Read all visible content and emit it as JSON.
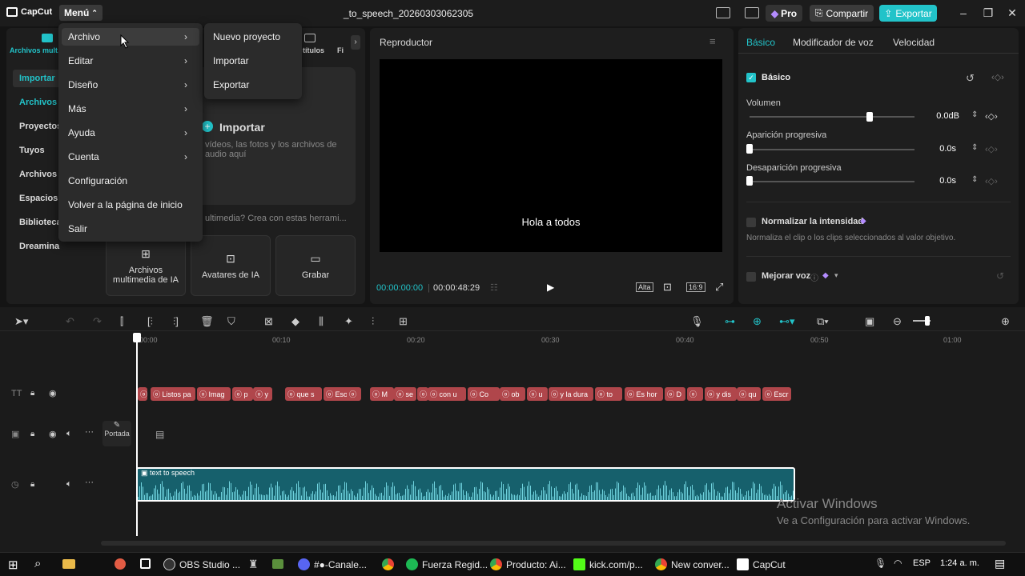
{
  "app": {
    "logo": "CapCut",
    "menu_label": "Menú",
    "project_title": "_to_speech_20260303062305"
  },
  "titlebar": {
    "pro_label": "Pro",
    "share_label": "Compartir",
    "export_label": "Exportar"
  },
  "left_panel": {
    "tabs": [
      {
        "label": "Archivos mult..."
      },
      {
        "label": "títulos"
      },
      {
        "label": "Fi"
      }
    ],
    "sidebar": [
      {
        "label": "Importar"
      },
      {
        "label": "Archivos"
      },
      {
        "label": "Proyectos"
      },
      {
        "label": "Tuyos"
      },
      {
        "label": "Archivos"
      },
      {
        "label": "Espacios"
      },
      {
        "label": "Biblioteca"
      },
      {
        "label": "Dreamina"
      }
    ],
    "import_label": "Importar",
    "import_hint": "vídeos, las fotos y los archivos de audio aquí",
    "ai_prompt": "ultimedia? Crea con estas herrami...",
    "ai_cards": [
      {
        "label": "Archivos multimedia de IA"
      },
      {
        "label": "Avatares de IA"
      },
      {
        "label": "Grabar"
      }
    ]
  },
  "player": {
    "title": "Reproductor",
    "subtitle": "Hola a todos",
    "current_time": "00:00:00:00",
    "total_time": "00:00:48:29",
    "quality": "Alta",
    "ratio": "16:9"
  },
  "right_panel": {
    "tabs": [
      "Básico",
      "Modificador de voz",
      "Velocidad"
    ],
    "section": "Básico",
    "volume_label": "Volumen",
    "volume_value": "0.0dB",
    "volume_level": 0.75,
    "fade_in_label": "Aparición progresiva",
    "fade_in_value": "0.0s",
    "fade_in_level": 0,
    "fade_out_label": "Desaparición progresiva",
    "fade_out_value": "0.0s",
    "fade_out_level": 0,
    "normalize_label": "Normalizar la intensidad",
    "normalize_desc": "Normaliza el clip o los clips seleccionados al valor objetivo.",
    "enhance_label": "Mejorar voz"
  },
  "timeline": {
    "ruler": [
      "00:00",
      "00:10",
      "00:20",
      "00:30",
      "00:40",
      "00:50",
      "01:00"
    ],
    "cover_label": "Portada",
    "audio_clip_label": "text to speech",
    "text_clips": [
      "",
      "Listos pa",
      "Imag",
      "p",
      "y",
      "que s",
      "Eso e",
      "",
      "M",
      "se",
      "",
      "con u",
      "Co",
      "ob",
      "u",
      "y la dura",
      "to",
      "Es hor",
      "D",
      "",
      "y dis",
      "qu",
      "Escr"
    ]
  },
  "watermark": {
    "title": "Activar Windows",
    "subtitle": "Ve a Configuración para activar Windows."
  },
  "menu": {
    "items": [
      {
        "label": "Archivo",
        "has_submenu": true
      },
      {
        "label": "Editar",
        "has_submenu": true
      },
      {
        "label": "Diseño",
        "has_submenu": true
      },
      {
        "label": "Más",
        "has_submenu": true
      },
      {
        "label": "Ayuda",
        "has_submenu": true
      },
      {
        "label": "Cuenta",
        "has_submenu": true
      },
      {
        "label": "Configuración",
        "has_submenu": false
      },
      {
        "label": "Volver a la página de inicio",
        "has_submenu": false
      },
      {
        "label": "Salir",
        "has_submenu": false
      }
    ],
    "submenu": [
      {
        "label": "Nuevo proyecto"
      },
      {
        "label": "Importar"
      },
      {
        "label": "Exportar"
      }
    ]
  },
  "taskbar": {
    "items": [
      {
        "label": "OBS Studio ..."
      },
      {
        "label": "#●-Canale..."
      },
      {
        "label": "Fuerza Regid..."
      },
      {
        "label": "Producto: Ai..."
      },
      {
        "label": "kick.com/p..."
      },
      {
        "label": "New conver..."
      },
      {
        "label": "CapCut"
      }
    ],
    "lang": "ESP",
    "clock": "1:24 a. m."
  },
  "colors": {
    "accent": "#22c3c9",
    "text_clip": "#b0464b",
    "audio_clip": "#16606c"
  }
}
